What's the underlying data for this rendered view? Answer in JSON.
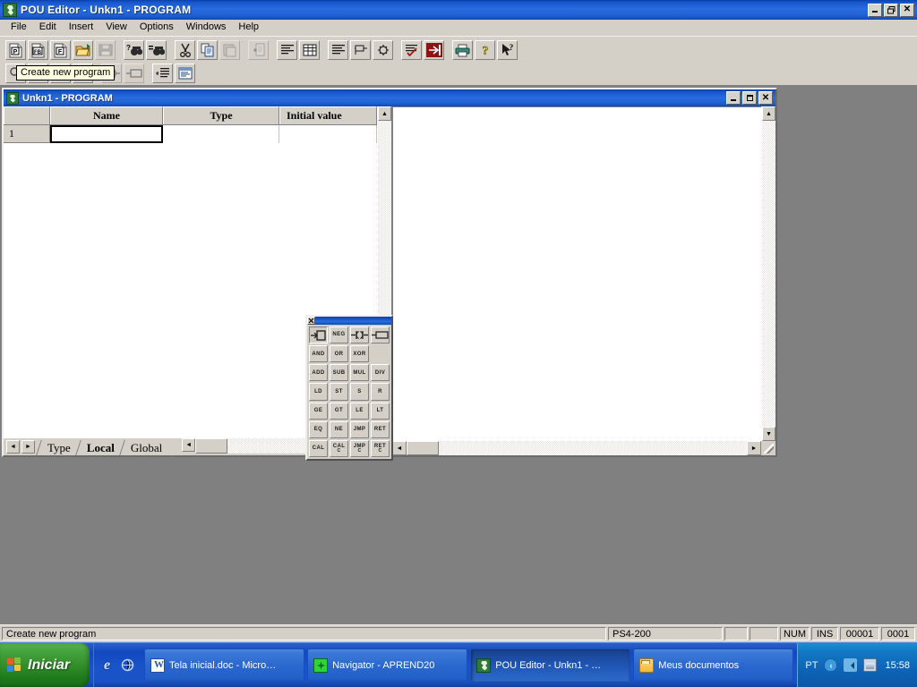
{
  "window": {
    "title": "POU Editor - Unkn1 - PROGRAM",
    "icon": "pou-editor-icon",
    "minimize_label": "_",
    "restore_label": "❐",
    "close_label": "✕"
  },
  "menu": {
    "items": [
      {
        "label": "File"
      },
      {
        "label": "Edit"
      },
      {
        "label": "Insert"
      },
      {
        "label": "View"
      },
      {
        "label": "Options"
      },
      {
        "label": "Windows"
      },
      {
        "label": "Help"
      }
    ]
  },
  "toolbar1": {
    "buttons": [
      {
        "name": "new-program-button",
        "icon": "document-p-icon",
        "glyph": "P",
        "state": "raised"
      },
      {
        "name": "new-function-block-button",
        "icon": "document-fb-icon",
        "glyph": "FB",
        "state": "raised"
      },
      {
        "name": "new-function-button",
        "icon": "document-f-icon",
        "glyph": "F",
        "state": "raised"
      },
      {
        "name": "open-button",
        "icon": "open-folder-icon",
        "glyph": "",
        "state": "raised"
      },
      {
        "name": "save-button",
        "icon": "floppy-save-icon",
        "glyph": "",
        "state": "disabled"
      },
      {
        "name": "find-button",
        "icon": "find-binoculars-icon",
        "glyph": "?",
        "state": "raised"
      },
      {
        "name": "find-next-button",
        "icon": "find-next-binoculars-icon",
        "glyph": "=",
        "state": "raised"
      },
      {
        "name": "cut-button",
        "icon": "scissors-icon",
        "glyph": "",
        "state": "raised"
      },
      {
        "name": "copy-button",
        "icon": "copy-icon",
        "glyph": "",
        "state": "raised"
      },
      {
        "name": "paste-button",
        "icon": "paste-icon",
        "glyph": "",
        "state": "disabled"
      },
      {
        "name": "insert-row-button",
        "icon": "insert-row-icon",
        "glyph": "",
        "state": "disabled"
      },
      {
        "name": "instruction-list-button",
        "icon": "instruction-list-icon",
        "glyph": "",
        "state": "raised"
      },
      {
        "name": "table-view-button",
        "icon": "table-grid-icon",
        "glyph": "",
        "state": "raised"
      },
      {
        "name": "ladder-list-button",
        "icon": "ladder-list-icon",
        "glyph": "",
        "state": "raised"
      },
      {
        "name": "network-button",
        "icon": "network-flag-icon",
        "glyph": "",
        "state": "raised"
      },
      {
        "name": "compile-button",
        "icon": "gear-circuit-icon",
        "glyph": "",
        "state": "raised"
      },
      {
        "name": "check-syntax-button",
        "icon": "checklist-icon",
        "glyph": "",
        "state": "raised"
      },
      {
        "name": "exit-button",
        "icon": "red-exit-arrow-icon",
        "glyph": "",
        "state": "raised"
      },
      {
        "name": "print-button",
        "icon": "printer-icon",
        "glyph": "",
        "state": "raised"
      },
      {
        "name": "help-button",
        "icon": "question-mark-icon",
        "glyph": "?",
        "state": "raised"
      },
      {
        "name": "context-help-button",
        "icon": "arrow-question-icon",
        "glyph": "",
        "state": "raised"
      }
    ]
  },
  "toolbar2": {
    "buttons": [
      {
        "name": "contact-button",
        "icon": "contact-symbol-icon",
        "state": "disabled"
      },
      {
        "name": "coil-button",
        "icon": "coil-symbol-icon",
        "state": "disabled"
      },
      {
        "name": "indent-list-button",
        "icon": "indent-list-icon",
        "state": "raised"
      },
      {
        "name": "edit-window-button",
        "icon": "edit-window-icon",
        "state": "raised"
      }
    ]
  },
  "tooltip": {
    "text": "Create new program"
  },
  "child_window": {
    "title": "Unkn1 - PROGRAM",
    "icon": "pou-document-icon",
    "minimize_label": "_",
    "maximize_label": "□",
    "close_label": "✕",
    "grid": {
      "columns": [
        "",
        "Name",
        "Type",
        "Initial value"
      ],
      "rows": [
        {
          "number": "1",
          "name": "",
          "type": "",
          "initial_value": ""
        }
      ]
    },
    "tabs": [
      {
        "label": "Type",
        "active": false
      },
      {
        "label": "Local",
        "active": true
      },
      {
        "label": "Global",
        "active": false
      }
    ],
    "tab_nav": {
      "prev": "◄",
      "next": "►"
    },
    "scroll": {
      "up": "▲",
      "down": "▼",
      "left": "◄",
      "right": "►"
    }
  },
  "palette": {
    "name": "instruction-palette",
    "close_label": "✕",
    "buttons": [
      {
        "label": "",
        "icon": "assign-box-icon",
        "selected": true
      },
      {
        "label": "NEG",
        "icon": "",
        "selected": false
      },
      {
        "label": "",
        "icon": "contact-symbol-icon",
        "selected": false
      },
      {
        "label": "",
        "icon": "coil-symbol-icon",
        "selected": false
      },
      {
        "label": "AND",
        "icon": "",
        "selected": false
      },
      {
        "label": "OR",
        "icon": "",
        "selected": false
      },
      {
        "label": "XOR",
        "icon": "",
        "selected": false
      },
      {
        "label": "",
        "icon": "",
        "selected": false,
        "empty": true
      },
      {
        "label": "ADD",
        "icon": "",
        "selected": false
      },
      {
        "label": "SUB",
        "icon": "",
        "selected": false
      },
      {
        "label": "MUL",
        "icon": "",
        "selected": false
      },
      {
        "label": "DIV",
        "icon": "",
        "selected": false
      },
      {
        "label": "LD",
        "icon": "",
        "selected": false
      },
      {
        "label": "ST",
        "icon": "",
        "selected": false
      },
      {
        "label": "S",
        "icon": "",
        "selected": false
      },
      {
        "label": "R",
        "icon": "",
        "selected": false
      },
      {
        "label": "GE",
        "icon": "",
        "selected": false
      },
      {
        "label": "GT",
        "icon": "",
        "selected": false
      },
      {
        "label": "LE",
        "icon": "",
        "selected": false
      },
      {
        "label": "LT",
        "icon": "",
        "selected": false
      },
      {
        "label": "EQ",
        "icon": "",
        "selected": false
      },
      {
        "label": "NE",
        "icon": "",
        "selected": false
      },
      {
        "label": "JMP",
        "icon": "",
        "selected": false
      },
      {
        "label": "RET",
        "icon": "",
        "selected": false
      },
      {
        "label": "CAL",
        "icon": "",
        "selected": false
      },
      {
        "label": "CAL",
        "sub": "C",
        "icon": "",
        "selected": false
      },
      {
        "label": "JMP",
        "sub": "C",
        "icon": "",
        "selected": false
      },
      {
        "label": "RET",
        "sub": "C",
        "icon": "",
        "selected": false
      }
    ]
  },
  "statusbar": {
    "message": "Create new program",
    "device": "PS4-200",
    "spare1": "",
    "spare2": "",
    "num_lock": "NUM",
    "insert_mode": "INS",
    "line": "00001",
    "column": "0001"
  },
  "taskbar": {
    "start_label": "Iniciar",
    "quick_launch": [
      {
        "name": "internet-explorer-icon",
        "label": "e"
      },
      {
        "name": "show-desktop-icon",
        "label": "e"
      }
    ],
    "tasks": [
      {
        "label": "Tela inicial.doc - Micro…",
        "icon": "word-document-icon",
        "active": false
      },
      {
        "label": "Navigator - APREND20",
        "icon": "navigator-icon",
        "active": false
      },
      {
        "label": "POU Editor - Unkn1 - …",
        "icon": "pou-editor-icon",
        "active": true
      },
      {
        "label": "Meus documentos",
        "icon": "folder-icon",
        "active": false
      }
    ],
    "tray": {
      "language": "PT",
      "icons": [
        "shield-icon",
        "volume-icon",
        "network-icon"
      ],
      "clock": "15:58"
    }
  },
  "colors": {
    "title_blue": "#1756cd",
    "face": "#d4d0c8",
    "desktop_gray": "#808080",
    "taskbar_blue": "#1348c0",
    "start_green": "#2f8c27",
    "tooltip_yellow": "#ffffe1"
  }
}
